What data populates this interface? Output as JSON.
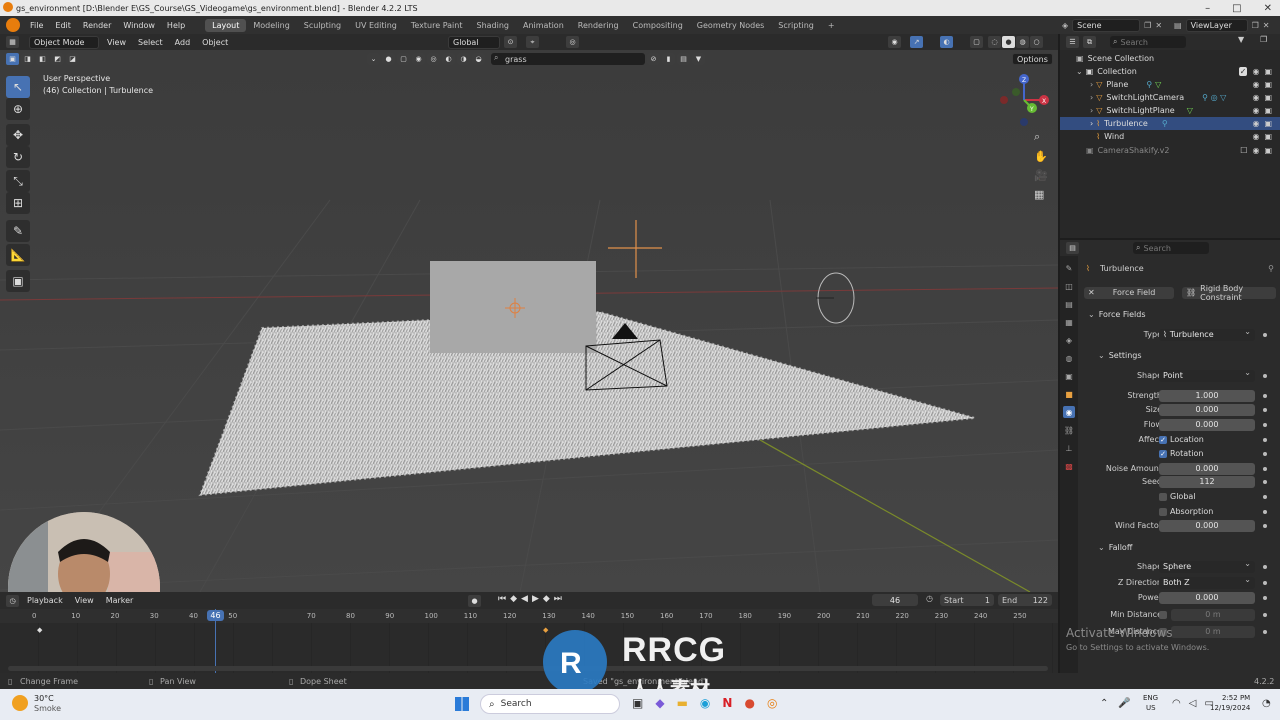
{
  "window": {
    "title": "gs_environment [D:\\Blender E\\GS_Course\\GS_Videogame\\gs_environment.blend] - Blender 4.2.2 LTS",
    "controls": [
      "–",
      "□",
      "✕"
    ]
  },
  "menu": {
    "items": [
      "File",
      "Edit",
      "Render",
      "Window",
      "Help"
    ],
    "workspaces": [
      "Layout",
      "Modeling",
      "Sculpting",
      "UV Editing",
      "Texture Paint",
      "Shading",
      "Animation",
      "Rendering",
      "Compositing",
      "Geometry Nodes",
      "Scripting"
    ],
    "active_workspace": "Layout",
    "add_tab": "+",
    "scene": "Scene",
    "view_layer": "ViewLayer"
  },
  "viewport": {
    "mode": "Object Mode",
    "menus": [
      "View",
      "Select",
      "Add",
      "Object"
    ],
    "orientation": "Global",
    "search_value": "grass",
    "options_label": "Options",
    "overlay_title": "User Perspective",
    "overlay_subtitle": "(46) Collection | Turbulence",
    "gizmo_axes": [
      "X",
      "Y",
      "Z"
    ]
  },
  "timeline": {
    "menus": [
      "Playback",
      "View",
      "Marker"
    ],
    "current_frame": "46",
    "start_label": "Start",
    "start_value": "1",
    "end_label": "End",
    "end_value": "122",
    "ruler": [
      "0",
      "10",
      "20",
      "30",
      "40",
      "50",
      "70",
      "80",
      "90",
      "100",
      "110",
      "120",
      "130",
      "140",
      "150",
      "160",
      "170",
      "180",
      "190",
      "200",
      "210",
      "220",
      "230",
      "240",
      "250"
    ],
    "playhead": "46"
  },
  "statusbar": {
    "items": [
      "Change Frame",
      "Pan View",
      "Dope Sheet"
    ],
    "message": "Saved \"gs_environment.blend\"",
    "version": "4.2.2"
  },
  "outliner": {
    "search_placeholder": "Search",
    "root": "Scene Collection",
    "collection": "Collection",
    "items": [
      {
        "name": "Plane",
        "selected": false
      },
      {
        "name": "SwitchLightCamera",
        "selected": false
      },
      {
        "name": "SwitchLightPlane",
        "selected": false
      },
      {
        "name": "Turbulence",
        "selected": true
      },
      {
        "name": "Wind",
        "selected": false
      }
    ],
    "extra": "CameraShakify.v2"
  },
  "properties": {
    "search_placeholder": "Search",
    "object_name": "Turbulence",
    "buttons": [
      "Force Field",
      "Rigid Body Constraint"
    ],
    "section_force_fields": "Force Fields",
    "type_label": "Type",
    "type_value": "Turbulence",
    "section_settings": "Settings",
    "settings": [
      {
        "label": "Shape",
        "value": "Point",
        "kind": "dropdown"
      },
      {
        "label": "Strength",
        "value": "1.000",
        "kind": "number"
      },
      {
        "label": "Size",
        "value": "0.000",
        "kind": "number"
      },
      {
        "label": "Flow",
        "value": "0.000",
        "kind": "number"
      }
    ],
    "affect_label": "Affect",
    "affect_options": [
      {
        "label": "Location",
        "checked": true
      },
      {
        "label": "Rotation",
        "checked": true
      }
    ],
    "noise_label": "Noise Amount",
    "noise_value": "0.000",
    "seed_label": "Seed",
    "seed_value": "112",
    "global_label": "Global",
    "absorption_label": "Absorption",
    "wind_factor_label": "Wind Factor",
    "wind_factor_value": "0.000",
    "section_falloff": "Falloff",
    "falloff": [
      {
        "label": "Shape",
        "value": "Sphere",
        "kind": "dropdown"
      },
      {
        "label": "Z Direction",
        "value": "Both Z",
        "kind": "dropdown"
      },
      {
        "label": "Power",
        "value": "0.000",
        "kind": "number"
      },
      {
        "label": "Min Distance",
        "value": "0 m",
        "kind": "dim"
      },
      {
        "label": "Max Distance",
        "value": "0 m",
        "kind": "dim"
      }
    ]
  },
  "overlay": {
    "activate_title": "Activate Windows",
    "activate_sub": "Go to Settings to activate Windows.",
    "watermark_big": "RRCG",
    "watermark_small": "人人素材"
  },
  "taskbar": {
    "weather_temp": "30°C",
    "weather_desc": "Smoke",
    "search_label": "Search",
    "lang": "ENG",
    "region": "US",
    "time": "2:52 PM",
    "date": "12/19/2024"
  },
  "colors": {
    "accent": "#4772b3",
    "selection": "#334d80",
    "viewport_bg": "#3f3f3f"
  }
}
